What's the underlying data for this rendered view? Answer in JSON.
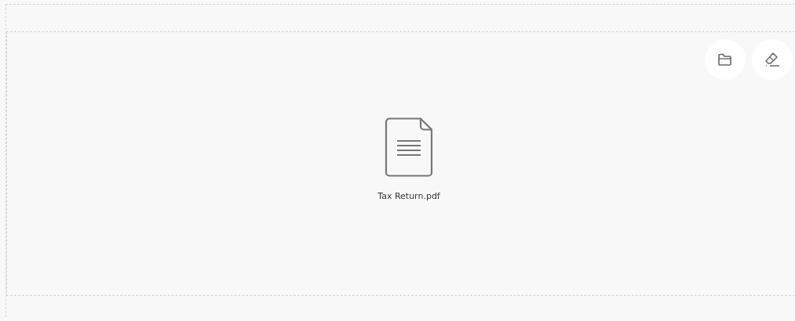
{
  "drop_zone": {
    "actions": [
      {
        "kind": "folder"
      },
      {
        "kind": "eraser"
      }
    ],
    "file": {
      "name": "Tax Return.pdf"
    }
  }
}
